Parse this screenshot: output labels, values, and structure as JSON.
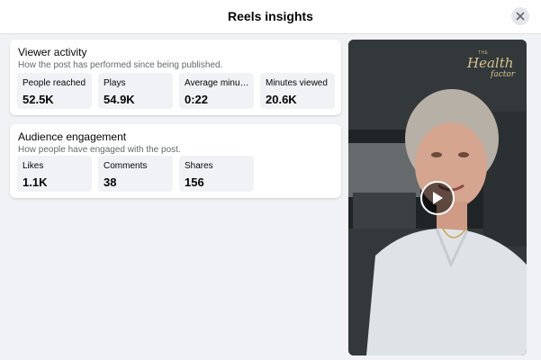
{
  "header": {
    "title": "Reels insights"
  },
  "viewer_activity": {
    "title": "Viewer activity",
    "subtitle": "How the post has performed since being published.",
    "stats": [
      {
        "label": "People reached",
        "value": "52.5K"
      },
      {
        "label": "Plays",
        "value": "54.9K"
      },
      {
        "label": "Average minutes viewed",
        "value": "0:22"
      },
      {
        "label": "Minutes viewed",
        "value": "20.6K"
      }
    ]
  },
  "audience_engagement": {
    "title": "Audience engagement",
    "subtitle": "How people have engaged with the post.",
    "stats": [
      {
        "label": "Likes",
        "value": "1.1K"
      },
      {
        "label": "Comments",
        "value": "38"
      },
      {
        "label": "Shares",
        "value": "156"
      }
    ]
  },
  "video": {
    "brand_the": "THE",
    "brand_health": "Health",
    "brand_factor": "factor",
    "play_icon": "play-icon"
  },
  "icons": {
    "close": "close-icon"
  },
  "colors": {
    "background": "#f0f2f5",
    "card": "#ffffff",
    "secondary_text": "#65676b"
  }
}
